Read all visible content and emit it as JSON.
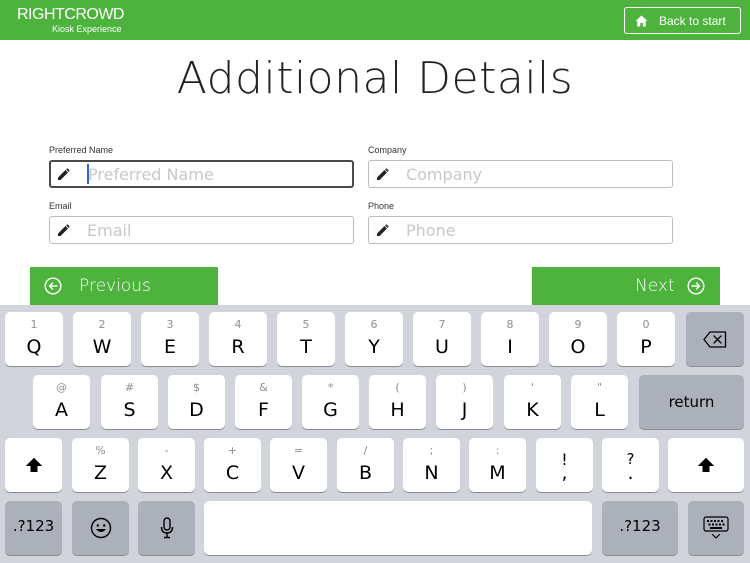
{
  "header": {
    "brand_name": "RIGHTCROWD",
    "brand_sub": "Kiosk Experience",
    "back_label": "Back to start",
    "home_icon": "home-icon",
    "bg_color": "#4db33d"
  },
  "page": {
    "title": "Additional Details"
  },
  "form": {
    "preferred_name": {
      "label": "Preferred Name",
      "placeholder": "Preferred Name",
      "value": ""
    },
    "company": {
      "label": "Company",
      "placeholder": "Company",
      "value": ""
    },
    "email": {
      "label": "Email",
      "placeholder": "Email",
      "value": ""
    },
    "phone": {
      "label": "Phone",
      "placeholder": "Phone",
      "value": ""
    },
    "field_icon": "pencil-icon"
  },
  "nav": {
    "previous_label": "Previous",
    "next_label": "Next",
    "accent_color": "#4db33d"
  },
  "keyboard": {
    "row1": [
      {
        "pri": "Q",
        "sec": "1"
      },
      {
        "pri": "W",
        "sec": "2"
      },
      {
        "pri": "E",
        "sec": "3"
      },
      {
        "pri": "R",
        "sec": "4"
      },
      {
        "pri": "T",
        "sec": "5"
      },
      {
        "pri": "Y",
        "sec": "6"
      },
      {
        "pri": "U",
        "sec": "7"
      },
      {
        "pri": "I",
        "sec": "8"
      },
      {
        "pri": "O",
        "sec": "9"
      },
      {
        "pri": "P",
        "sec": "0"
      }
    ],
    "row2": [
      {
        "pri": "A",
        "sec": "@"
      },
      {
        "pri": "S",
        "sec": "#"
      },
      {
        "pri": "D",
        "sec": "$"
      },
      {
        "pri": "F",
        "sec": "&"
      },
      {
        "pri": "G",
        "sec": "*"
      },
      {
        "pri": "H",
        "sec": "("
      },
      {
        "pri": "J",
        "sec": ")"
      },
      {
        "pri": "K",
        "sec": "'"
      },
      {
        "pri": "L",
        "sec": "\""
      }
    ],
    "row3": [
      {
        "pri": "Z",
        "sec": "%"
      },
      {
        "pri": "X",
        "sec": "-"
      },
      {
        "pri": "C",
        "sec": "+"
      },
      {
        "pri": "V",
        "sec": "="
      },
      {
        "pri": "B",
        "sec": "/"
      },
      {
        "pri": "N",
        "sec": ";"
      },
      {
        "pri": "M",
        "sec": ":"
      },
      {
        "pri": ",",
        "sec": "!"
      },
      {
        "pri": ".",
        "sec": "?"
      }
    ],
    "return_label": "return",
    "numbers_label": ".?123",
    "icons": {
      "backspace": "backspace-icon",
      "shift": "shift-icon",
      "emoji": "emoji-icon",
      "mic": "microphone-icon",
      "hide": "keyboard-hide-icon"
    }
  }
}
